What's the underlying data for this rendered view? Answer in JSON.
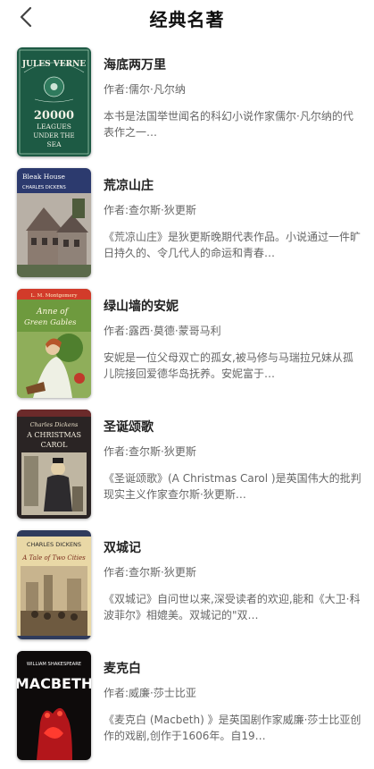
{
  "header": {
    "title": "经典名著"
  },
  "books": [
    {
      "title": "海底两万里",
      "author": "作者:儒尔·凡尔纳",
      "desc": "本书是法国举世闻名的科幻小说作家儒尔·凡尔纳的代表作之一…",
      "cover_text": [
        "JULES VERNE",
        "20000",
        "LEAGUES",
        "UNDER THE",
        "SEA"
      ]
    },
    {
      "title": "荒凉山庄",
      "author": "作者:查尔斯·狄更斯",
      "desc": "《荒凉山庄》是狄更斯晚期代表作品。小说通过一件旷日持久的、令几代人的命运和青春…",
      "cover_text": [
        "Bleak House",
        "CHARLES DICKENS"
      ]
    },
    {
      "title": "绿山墙的安妮",
      "author": "作者:露西·莫德·蒙哥马利",
      "desc": "安妮是一位父母双亡的孤女,被马修与马瑞拉兄妹从孤儿院接回爱德华岛抚养。安妮富于…",
      "cover_text": [
        "L. M. Montgomery",
        "Anne of",
        "Green Gables"
      ]
    },
    {
      "title": "圣诞颂歌",
      "author": "作者:查尔斯·狄更斯",
      "desc": "《圣诞颂歌》(A Christmas Carol )是英国伟大的批判现实主义作家查尔斯·狄更斯…",
      "cover_text": [
        "Charles Dickens",
        "A CHRISTMAS",
        "CAROL"
      ]
    },
    {
      "title": "双城记",
      "author": "作者:查尔斯·狄更斯",
      "desc": "《双城记》自问世以来,深受读者的欢迎,能和《大卫·科波菲尔》相媲美。双城记的\"双…",
      "cover_text": [
        "CHARLES DICKENS",
        "A Tale of Two Cities"
      ]
    },
    {
      "title": "麦克白",
      "author": "作者:威廉·莎士比亚",
      "desc": "《麦克白 (Macbeth) 》是英国剧作家威廉·莎士比亚创作的戏剧,创作于1606年。自19…",
      "cover_text": [
        "WILLIAM SHAKESPEARE",
        "MACBETH"
      ]
    }
  ]
}
